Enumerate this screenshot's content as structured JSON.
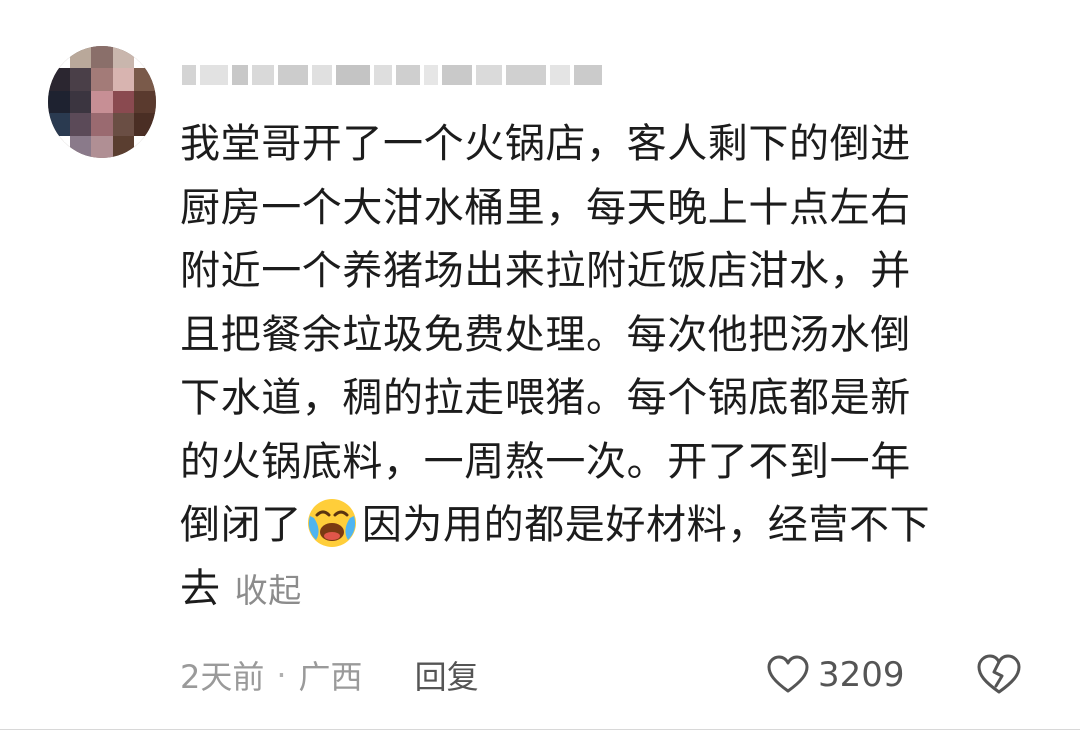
{
  "comment": {
    "avatar_icon": "avatar-mosaic-icon",
    "username_redacted": true,
    "lines": [
      "我堂哥开了一个火锅店，客人剩下的倒进",
      "厨房一个大泔水桶里，每天晚上十点左右",
      "附近一个养猪场出来拉附近饭店泔水，并",
      "且把餐余垃圾免费处理。每次他把汤水倒",
      "下水道，稠的拉走喂猪。每个锅底都是新",
      "的火锅底料，一周熬一次。开了不到一年",
      "倒闭了",
      "因为用的都是好材料，经营不下",
      "去"
    ],
    "emoji_icon": "crying-laughing-emoji-icon",
    "collapse_label": "收起",
    "time": "2天前",
    "separator": "·",
    "location": "广西",
    "reply_label": "回复",
    "like_icon": "heart-outline-icon",
    "like_count": "3209",
    "dislike_icon": "broken-heart-icon"
  }
}
